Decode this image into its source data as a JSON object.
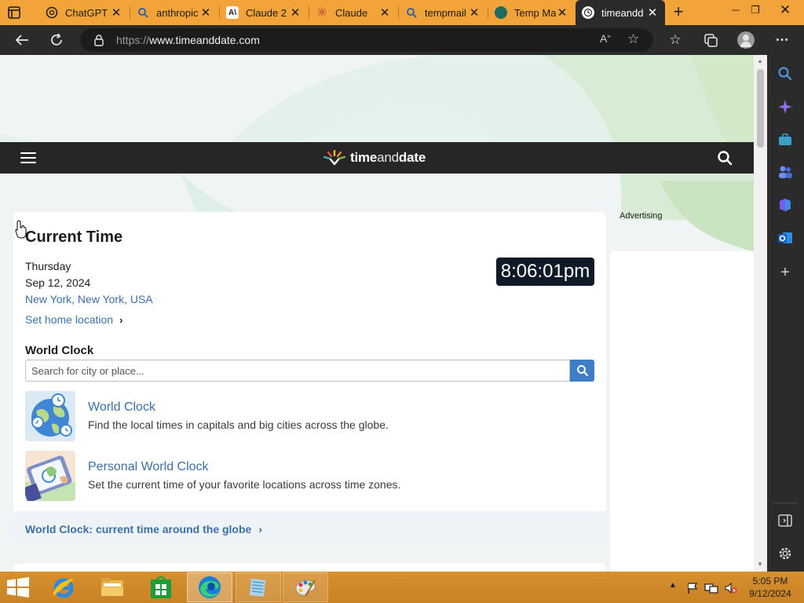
{
  "browser": {
    "tabs": [
      {
        "title": "ChatGPT",
        "icon": "chatgpt-icon"
      },
      {
        "title": "anthropic",
        "icon": "search-icon"
      },
      {
        "title": "Claude 2",
        "icon": "anthropic-icon"
      },
      {
        "title": "Claude",
        "icon": "claude-icon"
      },
      {
        "title": "tempmail",
        "icon": "search-icon"
      },
      {
        "title": "Temp Ma",
        "icon": "tempmail-icon"
      },
      {
        "title": "timeandd",
        "icon": "timeanddate-icon",
        "active": true
      }
    ],
    "url_prefix": "https://",
    "url_host": "www.timeanddate.com"
  },
  "site": {
    "logo_time": "time",
    "logo_and": "and",
    "logo_date": "date",
    "advertising_label": "Advertising"
  },
  "current_time": {
    "title": "Current Time",
    "day": "Thursday",
    "date": "Sep 12, 2024",
    "location": "New York, New York, USA",
    "set_home_label": "Set home location",
    "clock": "8:06:01pm"
  },
  "world_clock": {
    "title": "World Clock",
    "search_placeholder": "Search for city or place...",
    "features": [
      {
        "title": "World Clock",
        "description": "Find the local times in capitals and big cities across the globe."
      },
      {
        "title": "Personal World Clock",
        "description": "Set the current time of your favorite locations across time zones."
      }
    ],
    "footer_link": "World Clock: current time around the globe"
  },
  "taskbar": {
    "time": "5:05 PM",
    "date": "9/12/2024"
  },
  "colors": {
    "tabstrip": "#f2a43a",
    "taskbar": "#c98224",
    "site_header": "#262626",
    "link": "#3d6fa5",
    "clock_bg": "#0e1a28",
    "search_button": "#3f7dc6"
  }
}
